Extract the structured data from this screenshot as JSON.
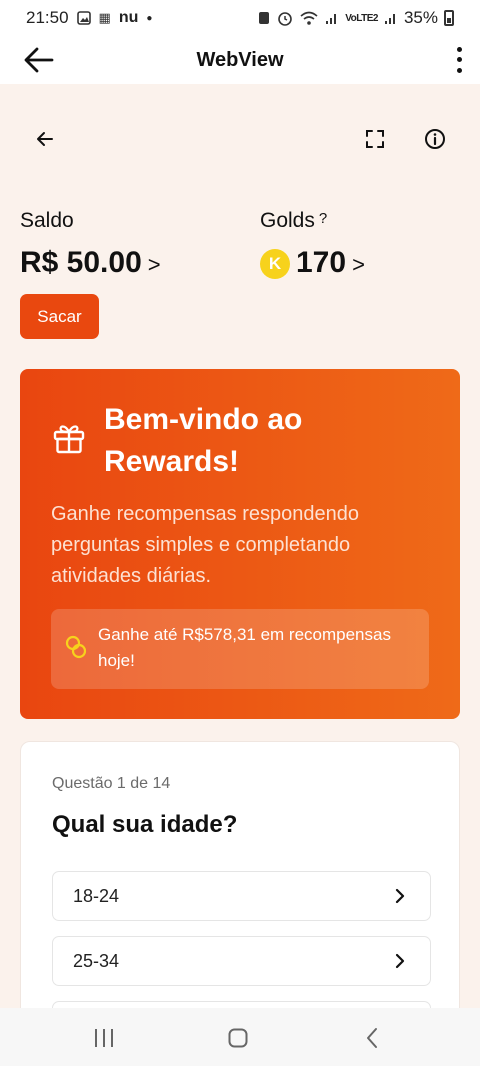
{
  "status_bar": {
    "time": "21:50",
    "left_icons": [
      "gallery-icon",
      "nu-bank-icon",
      "dot-icon"
    ],
    "carrier_label": "nu",
    "network_label": "VoLTE2",
    "battery": "35%"
  },
  "app_bar": {
    "title": "WebView",
    "back_icon": "arrow-left-icon",
    "menu_icon": "more-vertical-icon"
  },
  "top_icons": [
    "arrow-left-icon",
    "fullscreen-icon",
    "info-icon"
  ],
  "balance": {
    "saldo_label": "Saldo",
    "saldo_value": "R$ 50.00",
    "saldo_chevron": ">",
    "golds_label": "Golds",
    "golds_help": "?",
    "golds_coin_letter": "K",
    "golds_value": "170",
    "golds_chevron": ">",
    "withdraw_button": "Sacar"
  },
  "welcome_card": {
    "icon": "gift-icon",
    "title": "Bem-vindo ao Rewards!",
    "description": "Ganhe recompensas respondendo perguntas simples e completando atividades diárias.",
    "promo_icon": "coins-icon",
    "promo_text": "Ganhe até R$578,31 em recompensas hoje!"
  },
  "question": {
    "counter": "Questão 1 de 14",
    "title": "Qual sua idade?",
    "options": [
      {
        "label": "18-24"
      },
      {
        "label": "25-34"
      },
      {
        "label": ""
      }
    ]
  },
  "nav_bar": {
    "icons": [
      "recent-apps-icon",
      "home-icon",
      "back-icon"
    ]
  },
  "colors": {
    "accent": "#e9480f",
    "card_gradient_start": "#e94610",
    "card_gradient_end": "#ef6a18",
    "page_background": "#fbf2ec",
    "coin": "#f7d21c"
  }
}
